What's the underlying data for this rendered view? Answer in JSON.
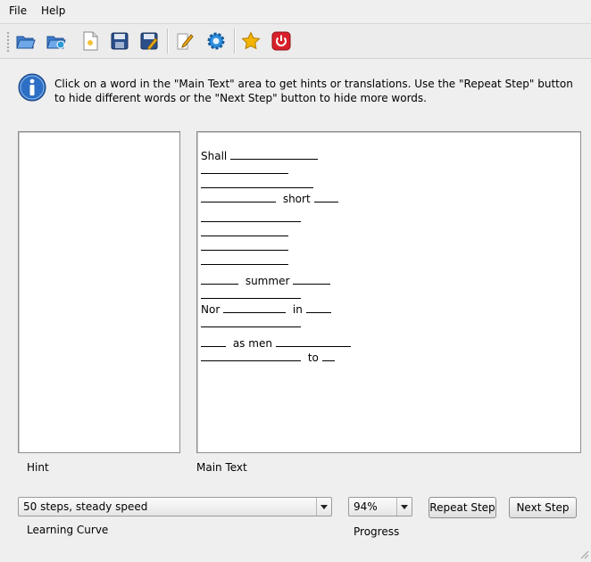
{
  "menu": {
    "file": "File",
    "help": "Help"
  },
  "toolbar_icons": [
    "open-folder-icon",
    "open-remote-icon",
    "new-document-icon",
    "save-icon",
    "save-as-icon",
    "edit-icon",
    "settings-gear-icon",
    "favorite-star-icon",
    "quit-power-icon"
  ],
  "instructions": "Click on a word in the \"Main Text\" area to get hints or translations. Use the \"Repeat Step\" button to hide different words or the \"Next Step\" button to hide more words.",
  "hint": {
    "label": "Hint",
    "content": ""
  },
  "main": {
    "label": "Main Text",
    "words": {
      "shall": "Shall",
      "short": "short",
      "summer": "summer",
      "nor": "Nor",
      "in": "in",
      "as_men": "as men",
      "to": "to"
    }
  },
  "learning_curve": {
    "value": "50 steps, steady speed",
    "label": "Learning Curve"
  },
  "progress": {
    "value": "94%",
    "label": "Progress"
  },
  "buttons": {
    "repeat": "Repeat Step",
    "next": "Next Step"
  },
  "colors": {
    "info_blue": "#2d6fc4",
    "star": "#f2b400",
    "power_red": "#d9202a"
  }
}
